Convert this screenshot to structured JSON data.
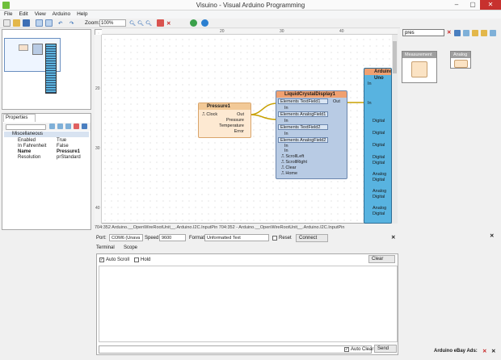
{
  "window": {
    "title": "Visuino - Visual Arduino Programming",
    "min": "–",
    "max": "▢",
    "close": "✕"
  },
  "menu": [
    "File",
    "Edit",
    "View",
    "Arduino",
    "Help"
  ],
  "toolbar": {
    "zoom_label": "Zoom:",
    "zoom_value": "100%"
  },
  "rulers": {
    "top": [
      "20",
      "30",
      "40"
    ],
    "left": [
      "20",
      "30",
      "40"
    ]
  },
  "properties": {
    "tab": "Properties",
    "group": "Miscellaneous",
    "rows": [
      {
        "key": "Enabled",
        "value": "True"
      },
      {
        "key": "In Fahrenheit",
        "value": "False"
      },
      {
        "key": "Name",
        "value": "Pressure1"
      },
      {
        "key": "Resolution",
        "value": "prStandard"
      }
    ]
  },
  "components": {
    "pressure": {
      "title": "Pressure1",
      "in_pin": "Clock",
      "out_pins": [
        "Out",
        "Pressure",
        "Temperature",
        "Error"
      ]
    },
    "lcd": {
      "title": "LiquidCrystalDisplay1",
      "pins": [
        "Elements TextField1",
        "In",
        "Elements AnalogField1",
        "In",
        "Elements TextField2",
        "In",
        "Elements AnalogField2",
        "In",
        "In",
        "ScrollLeft",
        "ScrollRight",
        "Clear",
        "Home"
      ],
      "out_label": "Out"
    },
    "arduino": {
      "title": "Arduino Uno",
      "pins": [
        "In",
        "In",
        "Digital",
        "Digital",
        "Digital",
        "Digital",
        "Digital",
        "Analog",
        "Digital",
        "Analog",
        "Digital",
        "Analog",
        "Digital"
      ]
    }
  },
  "status_text": "704:352   Arduino.__OpenWireRootUnit__.Arduino.I2C.InputPin 704:352 - Arduino.__OpenWireRootUnit__.Arduino.I2C.InputPin",
  "palette": {
    "search_value": "pres",
    "cat1": "Measurement",
    "cat2": "Analog"
  },
  "serial": {
    "port_label": "Port:",
    "port_value": "COM6 (Unava",
    "speed_label": "Speed:",
    "speed_value": "9600",
    "format_label": "Format:",
    "format_value": "Unformatted Text",
    "reset_label": "Reset",
    "connect_label": "Connect",
    "tabs": [
      "Terminal",
      "Scope"
    ],
    "auto_scroll": "Auto Scroll",
    "hold": "Hold",
    "clear": "Clear",
    "auto_clear": "Auto Clear",
    "send": "Send"
  },
  "footer": {
    "ads_label": "Arduino eBay Ads:"
  },
  "colors": {
    "canvas_bg": "#ffffff",
    "pressure_body": "#fde9d2",
    "lcd_body": "#b8cbe4",
    "arduino_body": "#58b3e0",
    "wire": "#c8a000"
  }
}
